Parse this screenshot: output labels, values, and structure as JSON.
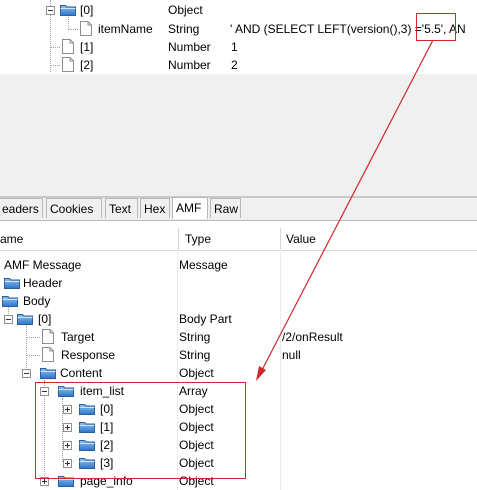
{
  "top_tree": {
    "rows": [
      {
        "name": "[0]",
        "type": "Object",
        "value": ""
      },
      {
        "name": "itemName",
        "type": "String",
        "value": "' AND (SELECT LEFT(version(),3) ='5.5', AN"
      },
      {
        "name": "[1]",
        "type": "Number",
        "value": "1"
      },
      {
        "name": "[2]",
        "type": "Number",
        "value": "2"
      }
    ]
  },
  "tabs": [
    {
      "label": "eaders"
    },
    {
      "label": "Cookies"
    },
    {
      "label": "Text"
    },
    {
      "label": "Hex"
    },
    {
      "label": "AMF"
    },
    {
      "label": "Raw"
    }
  ],
  "columns": {
    "name": "ame",
    "type": "Type",
    "value": "Value"
  },
  "tree": {
    "amf_message": {
      "name": "AMF Message",
      "type": "Message"
    },
    "header": {
      "name": "Header"
    },
    "body": {
      "name": "Body"
    },
    "body_0": {
      "name": "[0]",
      "type": "Body Part"
    },
    "target": {
      "name": "Target",
      "type": "String",
      "value": "/2/onResult"
    },
    "response": {
      "name": "Response",
      "type": "String",
      "value": "null"
    },
    "content": {
      "name": "Content",
      "type": "Object"
    },
    "item_list": {
      "name": "item_list",
      "type": "Array"
    },
    "items": [
      {
        "name": "[0]",
        "type": "Object"
      },
      {
        "name": "[1]",
        "type": "Object"
      },
      {
        "name": "[2]",
        "type": "Object"
      },
      {
        "name": "[3]",
        "type": "Object"
      }
    ],
    "page_info": {
      "name": "page_info",
      "type": "Object"
    }
  },
  "colors": {
    "annotation_red": "#d0282c",
    "folder_blue": "#3d7fd0"
  }
}
